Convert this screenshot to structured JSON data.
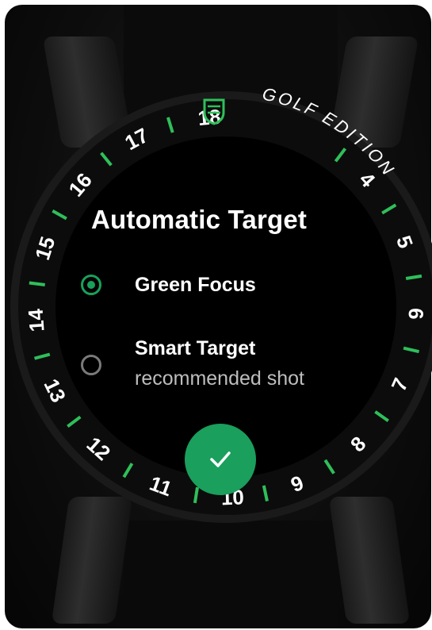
{
  "screen": {
    "title": "Automatic Target",
    "options": [
      {
        "label": "Green Focus",
        "sublabel": "",
        "selected": true
      },
      {
        "label": "Smart Target",
        "sublabel": "recommended shot",
        "selected": false
      }
    ],
    "confirm_icon": "checkmark-icon"
  },
  "bezel": {
    "brand_text": "GOLF EDITION",
    "hole_numbers": [
      "18",
      "17",
      "16",
      "15",
      "14",
      "13",
      "12",
      "11",
      "10",
      "9",
      "8",
      "7",
      "6",
      "5",
      "4"
    ],
    "logo_icon": "shield-logo-icon"
  },
  "colors": {
    "accent": "#1a9f5d",
    "marker": "#2fbf5a",
    "text": "#ffffff",
    "subtext": "#bdbdbd",
    "radio_off": "#7a7a7a",
    "bezel": "#111111"
  }
}
